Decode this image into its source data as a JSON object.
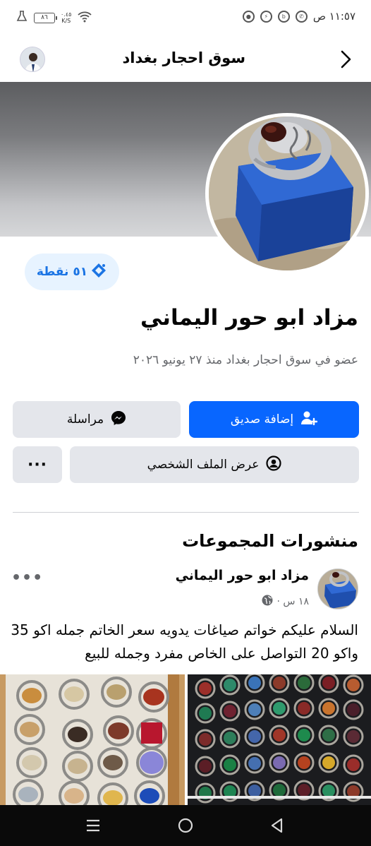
{
  "status_bar": {
    "time": "١١:٥٧ ص",
    "battery": "٨٦",
    "net_speed_value": "٠.٤٥",
    "net_speed_unit": "K/S",
    "icons": [
      "whatsapp-icon",
      "whatsapp-business-icon",
      "messenger-icon",
      "app-icon",
      "wifi-icon",
      "battery-icon",
      "lab-flask-icon"
    ]
  },
  "header": {
    "group_name": "سوق احجار بغداد",
    "back_icon": "chevron-right-icon"
  },
  "profile": {
    "points": "٥١ نقطة",
    "name": "مزاد ابو حور اليماني",
    "member_info": "عضو في سوق احجار بغداد منذ ٢٧ يونيو ٢٠٢٦"
  },
  "actions": {
    "add_friend": "إضافة صديق",
    "message": "مراسلة",
    "view_profile": "عرض الملف الشخصي",
    "more": "···"
  },
  "group_posts": {
    "section_title": "منشورات المجموعات",
    "post": {
      "author": "مزاد ابو حور اليماني",
      "time": "١٨ س ·",
      "options": "•••",
      "text": "السلام عليكم خواتم صياغات يدويه سعر الخاتم جمله اكو 35 واكو 20 التواصل على الخاص مفرد وجمله للبيع"
    }
  },
  "colors": {
    "primary": "#0866ff",
    "secondary_button": "#e4e6eb",
    "points_background": "#e7f3ff",
    "points_text": "#1b74e4",
    "muted_text": "#65676b"
  }
}
